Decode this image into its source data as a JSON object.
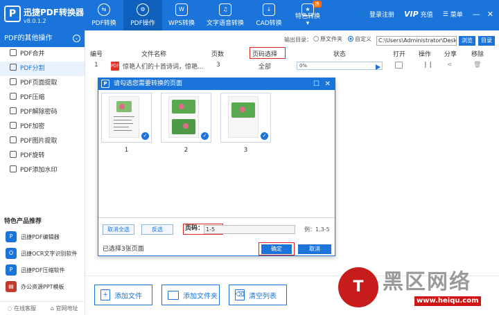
{
  "app": {
    "name": "迅捷PDF转换器",
    "version": "v8.0.1.2",
    "logo": "P"
  },
  "nav": [
    {
      "label": "PDF转换",
      "icon": "refresh-icon",
      "active": false
    },
    {
      "label": "PDF操作",
      "icon": "gear-icon",
      "active": true
    },
    {
      "label": "WPS转换",
      "icon": "wps-icon",
      "active": false
    },
    {
      "label": "文字语音转换",
      "icon": "audio-icon",
      "active": false
    },
    {
      "label": "CAD转换",
      "icon": "cad-icon",
      "active": false
    },
    {
      "label": "特色转换",
      "icon": "star-icon",
      "active": false,
      "badge": "热"
    }
  ],
  "top_right": {
    "login": "登录注册",
    "vip": "VIP",
    "recharge": "充值",
    "menu": "菜单"
  },
  "sidebar": {
    "header": "PDF的其他操作",
    "items": [
      {
        "label": "PDF合并",
        "active": false
      },
      {
        "label": "PDF分割",
        "active": true
      },
      {
        "label": "PDF页面提取",
        "active": false
      },
      {
        "label": "PDF压缩",
        "active": false
      },
      {
        "label": "PDF解除密码",
        "active": false
      },
      {
        "label": "PDF加密",
        "active": false
      },
      {
        "label": "PDF图片提取",
        "active": false
      },
      {
        "label": "PDF旋转",
        "active": false
      },
      {
        "label": "PDF添加水印",
        "active": false
      }
    ],
    "featured_title": "特色产品推荐",
    "featured": [
      {
        "label": "迅捷PDF编辑器",
        "icon": "P"
      },
      {
        "label": "迅捷OCR文字识别软件",
        "icon": "O"
      },
      {
        "label": "迅捷PDF压缩软件",
        "icon": "P"
      },
      {
        "label": "办公资源PPT模板",
        "icon": "▤"
      }
    ],
    "footer": {
      "service": "在线客服",
      "website": "官网地址"
    }
  },
  "output": {
    "label": "输出目录：",
    "option_original": "原文件夹",
    "option_custom": "自定义",
    "path": "C:\\Users\\Administrator\\Desktop",
    "browse": "浏览",
    "dir": "目录"
  },
  "table": {
    "headers": {
      "no": "编号",
      "filename": "文件名称",
      "pages": "页数",
      "page_select": "页码选择",
      "status": "状态",
      "open": "打开",
      "operate": "操作",
      "share": "分享",
      "remove": "移除"
    },
    "rows": [
      {
        "no": "1",
        "filename": "惊艳人们的十首诗词，惊艳...",
        "pages": "3",
        "page_select": "全部",
        "progress": "0%"
      }
    ]
  },
  "dialog": {
    "title": "请勾选您需要转换的页面",
    "pages": [
      "1",
      "2",
      "3"
    ],
    "deselect_all": "取消全选",
    "invert": "反选",
    "page_label": "页码：",
    "page_value": "1-5",
    "example": "例：1,3-5",
    "selected_status": "已选择3张页面",
    "ok": "确定",
    "cancel": "取消"
  },
  "bottom": {
    "add_file": "添加文件",
    "add_folder": "添加文件夹",
    "clear_list": "清空列表"
  },
  "watermark": {
    "text": "黑区网络",
    "url": "www.heiqu.com"
  },
  "colors": {
    "primary": "#1a74d9",
    "highlight": "#e02020"
  }
}
